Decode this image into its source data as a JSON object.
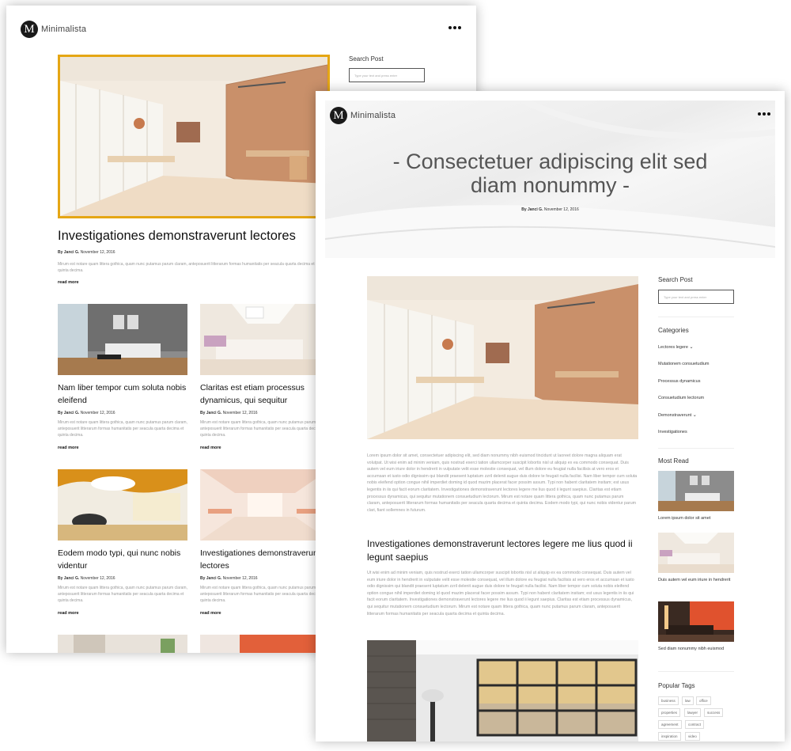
{
  "brand": {
    "letter": "M",
    "name": "Minimalista"
  },
  "back": {
    "featured": {
      "title": "Investigationes demonstraverunt lectores",
      "author": "By Janci G.",
      "date": "November 12, 2016",
      "excerpt": "Mirum est notare quam littera gothica, quam nunc putamus parum claram, anteposuerit litterarum formas humanitatis per seacula quarta decima et quinta decima.",
      "read_more": "read more"
    },
    "search": {
      "title": "Search Post",
      "placeholder": "Type your text and press enter"
    },
    "posts": [
      {
        "title": "Nam liber tempor cum soluta nobis eleifend",
        "author": "By Janci G.",
        "date": "November 12, 2016",
        "excerpt": "Mirum est notare quam littera gothica, quam nunc putamus parum claram, anteposuerit litterarum formas humanitatis per seacula quarta decima et quinta decima.",
        "read_more": "read more"
      },
      {
        "title": "Claritas est etiam processus dynamicus, qui sequitur",
        "author": "By Janci G.",
        "date": "November 12, 2016",
        "excerpt": "Mirum est notare quam littera gothica, quam nunc putamus parum claram, anteposuerit litterarum formas humanitatis per seacula quarta decima et quinta decima.",
        "read_more": "read more"
      },
      {
        "title": "Eodem modo typi, qui nunc nobis videntur",
        "author": "By Janci G.",
        "date": "November 12, 2016",
        "excerpt": "Mirum est notare quam littera gothica, quam nunc putamus parum claram, anteposuerit litterarum formas humanitatis per seacula quarta decima et quinta decima.",
        "read_more": "read more"
      },
      {
        "title": "Investigationes demonstraverunt lectores",
        "author": "By Janci G.",
        "date": "November 12, 2016",
        "excerpt": "Mirum est notare quam littera gothica, quam nunc putamus parum claram, anteposuerit litterarum formas humanitatis per seacula quarta decima et quinta decima.",
        "read_more": "read more"
      }
    ]
  },
  "front": {
    "hero": {
      "title": "- Consectetuer adipiscing elit sed diam nonummy -",
      "author": "By Janci G.",
      "date": "November 12, 2016"
    },
    "body_1": "Lorem ipsum dolor sit amet, consectetuer adipiscing elit, sed diam nonummy nibh euismod tincidunt ut laoreet dolore magna aliquam erat volutpat. Ut wisi enim ad minim veniam, quis nostrud exerci tation ullamcorper suscipit lobortis nisl ut aliquip ex ea commodo consequat. Duis autem vel eum iriure dolor in hendrerit in vulputate velit esse molestie consequat, vel illum dolore eu feugiat nulla facilisis at vero eros et accumsan et iusto odio dignissim qui blandit praesent luptatum zzril delenit augue duis dolore te feugait nulla facilisi. Nam liber tempor cum soluta nobis eleifend option congue nihil imperdiet doming id quod mazim placerat facer possim assum. Typi non habent claritatem insitam; est usus legentis in iis qui facit eorum claritatem. Investigationes demonstraverunt lectores legere me lius quod ii legunt saepius. Claritas est etiam processus dynamicus, qui sequitur mutationem consuetudium lectorum. Mirum est notare quam littera gothica, quam nunc putamus parum claram, anteposuerit litterarum formas humanitatis per seacula quarta decima et quinta decima. Eodem modo typi, qui nunc nobis videntur parum clari, fiant sollemnes in futurum.",
    "subheading": "Investigationes demonstraverunt lectores legere me lius quod ii legunt saepius",
    "body_2": "Ut wisi enim ad minim veniam, quis nostrud exerci tation ullamcorper suscipit lobortis nisl ut aliquip ex ea commodo consequat. Duis autem vel eum iriure dolor in hendrerit in vulputate velit esse molestie consequat, vel illum dolore eu feugiat nulla facilisis at vero eros et accumsan et iusto odio dignissim qui blandit praesent luptatum zzril delenit augue duis dolore te feugait nulla facilisi. Nam liber tempor cum soluta nobis eleifend option congue nihil imperdiet doming id quod mazim placerat facer possim assum. Typi non habent claritatem insitam; est usus legentis in iis qui facit eorum claritatem. Investigationes demonstraverunt lectores legere me lius quod ii legunt saepius. Claritas est etiam processus dynamicus, qui sequitur mutationem consuetudium lectorum. Mirum est notare quam littera gothica, quam nunc putamus parum claram, anteposuerit litterarum formas humanitatis per seacula quarta decima et quinta decima.",
    "sidebar": {
      "search_title": "Search Post",
      "search_placeholder": "Type your text and press enter",
      "categories_title": "Categories",
      "categories": [
        "Lectores legere",
        "Mutationem consuetudium",
        "Processus dynamicus",
        "Consuetudium lectorum",
        "Demonstraverunt",
        "Investigationes"
      ],
      "most_read_title": "Most Read",
      "most_read": [
        "Lorem ipsum dolor sit amet",
        "Duis autem vel eum iriure in hendrerit",
        "Sed diam nonummy nibh euismod"
      ],
      "tags_title": "Popular Tags",
      "tags": [
        "business",
        "law",
        "office",
        "properties",
        "lawyer",
        "success",
        "agreement",
        "contract",
        "inspiration",
        "video"
      ]
    }
  },
  "colors": {
    "accent": "#e5a614",
    "text": "#111111",
    "muted": "#9a9a9a"
  }
}
